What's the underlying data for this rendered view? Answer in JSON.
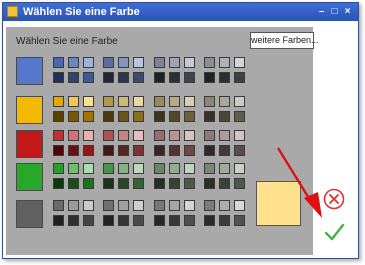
{
  "window": {
    "title": "Wählen Sie eine Farbe"
  },
  "panel": {
    "title": "Wählen Sie eine Farbe"
  },
  "buttons": {
    "more_colors": "weitere Farben..."
  },
  "selected_color": "#ffe08c",
  "icons": [
    "app-icon",
    "minimize-icon",
    "maximize-icon",
    "close-icon",
    "cancel-icon",
    "checkmark-icon",
    "red-arrow-annotation"
  ],
  "rows": [
    {
      "name": "blue",
      "base": "#5577cc",
      "variants": [
        [
          "#4a67a8",
          "#6a85c2",
          "#9eb2dc",
          "#1f2f58",
          "#2d4478",
          "#3d5a9c"
        ],
        [
          "#5a6fa0",
          "#8295bf",
          "#b8c5e0",
          "#202838",
          "#2a3550",
          "#3a4a70"
        ],
        [
          "#7a8496",
          "#9ea6b6",
          "#c4cad4",
          "#1e2228",
          "#2a3038",
          "#3c4450"
        ],
        [
          "#8a8e96",
          "#aeb2b8",
          "#d2d4d8",
          "#202226",
          "#2c2e32",
          "#3e4046"
        ]
      ]
    },
    {
      "name": "yellow",
      "base": "#f5b800",
      "variants": [
        [
          "#e6a800",
          "#f2c84a",
          "#f8e090",
          "#5a4000",
          "#7a5800",
          "#a07400"
        ],
        [
          "#b89848",
          "#d4b870",
          "#ecd8a0",
          "#4a3a10",
          "#6a5418",
          "#8a6e24"
        ],
        [
          "#9a8a5a",
          "#b8aa80",
          "#d8ceb0",
          "#3c3420",
          "#54482c",
          "#70603a"
        ],
        [
          "#8c8674",
          "#aca694",
          "#cecabc",
          "#363228",
          "#4a4538",
          "#625c4a"
        ]
      ]
    },
    {
      "name": "red",
      "base": "#c41818",
      "variants": [
        [
          "#c03030",
          "#d87070",
          "#ecb0b0",
          "#4a0808",
          "#6a1010",
          "#901818"
        ],
        [
          "#b05050",
          "#cc8080",
          "#e6bcbc",
          "#401818",
          "#5a2424",
          "#7a3434"
        ],
        [
          "#a06868",
          "#bc9292",
          "#dac2c2",
          "#3a2424",
          "#523434",
          "#6e4646"
        ],
        [
          "#8e7878",
          "#ae9c9c",
          "#d0c4c4",
          "#322828",
          "#463838",
          "#5e4c4c"
        ]
      ]
    },
    {
      "name": "green",
      "base": "#28a828",
      "variants": [
        [
          "#2e9a2e",
          "#6cc06c",
          "#acdcac",
          "#0a3a0a",
          "#105410",
          "#187418"
        ],
        [
          "#4c904c",
          "#80b480",
          "#bcd8bc",
          "#183418",
          "#244a24",
          "#346434"
        ],
        [
          "#668666",
          "#92ac92",
          "#c2d2c2",
          "#223022",
          "#324432",
          "#465c46"
        ],
        [
          "#788878",
          "#9eae9e",
          "#c8d0c8",
          "#283028",
          "#384238",
          "#4c584c"
        ]
      ]
    },
    {
      "name": "gray",
      "base": "#606060",
      "variants": [
        [
          "#6a6a6a",
          "#9a9a9a",
          "#cacaca",
          "#202020",
          "#303030",
          "#444444"
        ],
        [
          "#707070",
          "#a0a0a0",
          "#d0d0d0",
          "#242424",
          "#343434",
          "#4a4a4a"
        ],
        [
          "#767676",
          "#a6a6a6",
          "#d4d4d4",
          "#282828",
          "#383838",
          "#4e4e4e"
        ],
        [
          "#7c7c7c",
          "#acacac",
          "#d8d8d8",
          "#2a2a2a",
          "#3a3a3a",
          "#525252"
        ]
      ]
    }
  ]
}
